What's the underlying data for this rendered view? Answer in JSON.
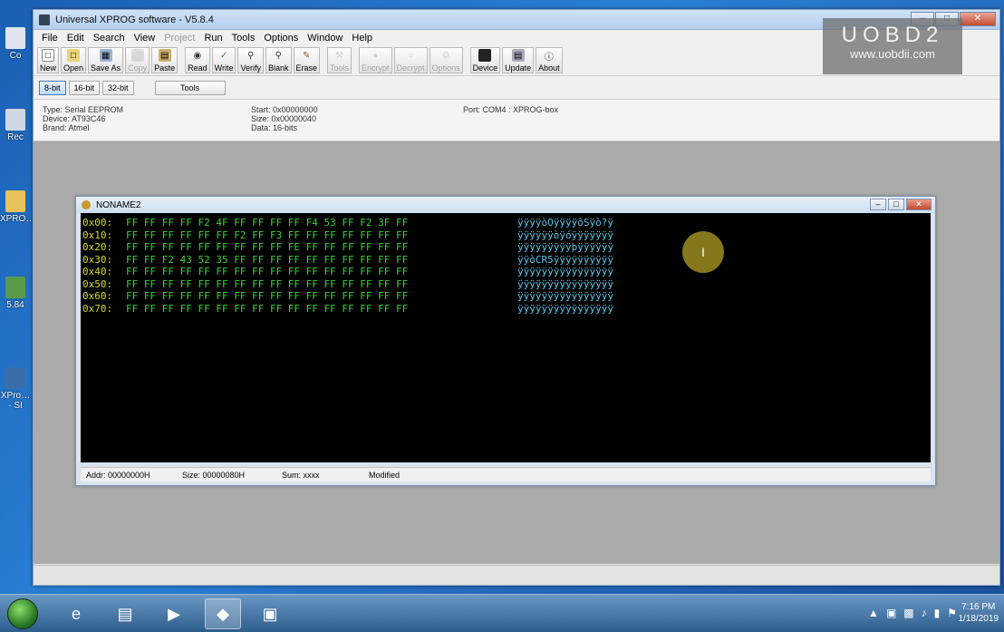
{
  "desktop": {
    "icons": [
      {
        "label": "Co",
        "icon": "computer-icon"
      },
      {
        "label": "Rec",
        "icon": "recycle-bin-icon"
      },
      {
        "label": "XPRO…",
        "icon": "folder-icon"
      },
      {
        "label": "5.84",
        "icon": "app-icon"
      },
      {
        "label": "XPro… - SI",
        "icon": "xprog-icon"
      }
    ]
  },
  "app": {
    "title": "Universal XPROG software - V5.8.4",
    "menu": [
      {
        "label": "File",
        "enabled": true
      },
      {
        "label": "Edit",
        "enabled": true
      },
      {
        "label": "Search",
        "enabled": true
      },
      {
        "label": "View",
        "enabled": true
      },
      {
        "label": "Project",
        "enabled": false
      },
      {
        "label": "Run",
        "enabled": true
      },
      {
        "label": "Tools",
        "enabled": true
      },
      {
        "label": "Options",
        "enabled": true
      },
      {
        "label": "Window",
        "enabled": true
      },
      {
        "label": "Help",
        "enabled": true
      }
    ],
    "toolbar": [
      {
        "label": "New",
        "icon": "new-file-icon",
        "enabled": true
      },
      {
        "label": "Open",
        "icon": "open-folder-icon",
        "enabled": true
      },
      {
        "label": "Save As",
        "icon": "save-as-icon",
        "enabled": true
      },
      {
        "label": "Copy",
        "icon": "copy-icon",
        "enabled": false
      },
      {
        "label": "Paste",
        "icon": "paste-icon",
        "enabled": true
      },
      {
        "label": "Read",
        "icon": "read-icon",
        "enabled": true
      },
      {
        "label": "Write",
        "icon": "write-icon",
        "enabled": true
      },
      {
        "label": "Verify",
        "icon": "verify-icon",
        "enabled": true
      },
      {
        "label": "Blank",
        "icon": "blank-icon",
        "enabled": true
      },
      {
        "label": "Erase",
        "icon": "erase-icon",
        "enabled": true
      },
      {
        "label": "Tools",
        "icon": "tools-icon",
        "enabled": false
      },
      {
        "label": "Encrypt",
        "icon": "encrypt-icon",
        "enabled": false
      },
      {
        "label": "Decrypt",
        "icon": "decrypt-icon",
        "enabled": false
      },
      {
        "label": "Options",
        "icon": "options-icon",
        "enabled": false
      },
      {
        "label": "Device",
        "icon": "device-icon",
        "enabled": true
      },
      {
        "label": "Update",
        "icon": "update-icon",
        "enabled": true
      },
      {
        "label": "About",
        "icon": "about-icon",
        "enabled": true
      }
    ],
    "bit_buttons": [
      "8-bit",
      "16-bit",
      "32-bit"
    ],
    "tools_button": "Tools",
    "info": {
      "type": "Type: Serial EEPROM",
      "device": "Device: AT93C46",
      "brand": "Brand: Atmel",
      "start": "Start: 0x00000000",
      "size": "Size: 0x00000040",
      "data": "Data: 16-bits",
      "port": "Port: COM4 : XPROG-box"
    }
  },
  "editor": {
    "title": "NONAME2",
    "rows": [
      {
        "addr": "0x00:",
        "bytes": "FF FF FF FF F2 4F FF FF FF FF F4 53 FF F2 3F FF",
        "ascii": "ÿÿÿÿòOÿÿÿÿôSÿò?ÿ"
      },
      {
        "addr": "0x10:",
        "bytes": "FF FF FF FF FF FF F2 FF F3 FF FF FF FF FF FF FF",
        "ascii": "ÿÿÿÿÿÿòÿóÿÿÿÿÿÿÿ"
      },
      {
        "addr": "0x20:",
        "bytes": "FF FF FF FF FF FF FF FF FF FE FF FF FF FF FF FF",
        "ascii": "ÿÿÿÿÿÿÿÿÿþÿÿÿÿÿÿ"
      },
      {
        "addr": "0x30:",
        "bytes": "FF FF F2 43 52 35 FF FF FF FF FF FF FF FF FF FF",
        "ascii": "ÿÿòCR5ÿÿÿÿÿÿÿÿÿÿ"
      },
      {
        "addr": "0x40:",
        "bytes": "FF FF FF FF FF FF FF FF FF FF FF FF FF FF FF FF",
        "ascii": "ÿÿÿÿÿÿÿÿÿÿÿÿÿÿÿÿ"
      },
      {
        "addr": "0x50:",
        "bytes": "FF FF FF FF FF FF FF FF FF FF FF FF FF FF FF FF",
        "ascii": "ÿÿÿÿÿÿÿÿÿÿÿÿÿÿÿÿ"
      },
      {
        "addr": "0x60:",
        "bytes": "FF FF FF FF FF FF FF FF FF FF FF FF FF FF FF FF",
        "ascii": "ÿÿÿÿÿÿÿÿÿÿÿÿÿÿÿÿ"
      },
      {
        "addr": "0x70:",
        "bytes": "FF FF FF FF FF FF FF FF FF FF FF FF FF FF FF FF",
        "ascii": "ÿÿÿÿÿÿÿÿÿÿÿÿÿÿÿÿ"
      }
    ],
    "status": {
      "addr": "Addr: 00000000H",
      "size": "Size: 00000080H",
      "sum": "Sum: xxxx",
      "state": "Modified"
    },
    "cursor_glyph": "I"
  },
  "watermark": {
    "line1": "UOBD2",
    "line2": "www.uobdii.com"
  },
  "taskbar": {
    "apps": [
      {
        "icon": "internet-explorer-icon",
        "glyph": "e",
        "active": false
      },
      {
        "icon": "file-explorer-icon",
        "glyph": "▤",
        "active": false
      },
      {
        "icon": "media-player-icon",
        "glyph": "▶",
        "active": false
      },
      {
        "icon": "xprog-chip-icon",
        "glyph": "◆",
        "active": true
      },
      {
        "icon": "window-app-icon",
        "glyph": "▣",
        "active": false
      }
    ],
    "time": "7:16 PM",
    "date": "1/18/2019"
  },
  "colors": {
    "hex_address": "#d7d71e",
    "hex_bytes": "#3ad13a",
    "hex_ascii": "#56c6e6",
    "hex_background": "#000000"
  }
}
